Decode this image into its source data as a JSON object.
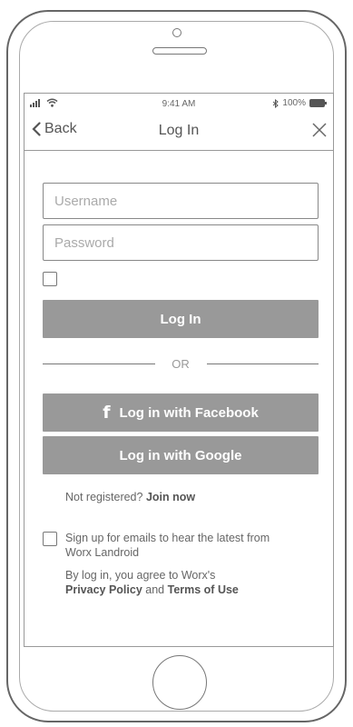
{
  "status_bar": {
    "time": "9:41 AM",
    "battery": "100%"
  },
  "nav": {
    "back_label": "Back",
    "title": "Log In"
  },
  "form": {
    "username_placeholder": "Username",
    "password_placeholder": "Password",
    "login_button": "Log In",
    "or_label": "OR",
    "facebook_button": "Log in with Facebook",
    "google_button": "Log in with Google"
  },
  "register": {
    "prompt": "Not registered?",
    "link": "Join now"
  },
  "email_opt_in": {
    "line1": "Sign up for emails to hear the latest from",
    "line2": "Worx Landroid"
  },
  "terms": {
    "line1": "By log in, you agree to Worx's",
    "privacy_link": "Privacy Policy",
    "and": "and",
    "terms_link": "Terms of Use"
  },
  "colors": {
    "button_gray": "#999999",
    "border": "#888888"
  }
}
